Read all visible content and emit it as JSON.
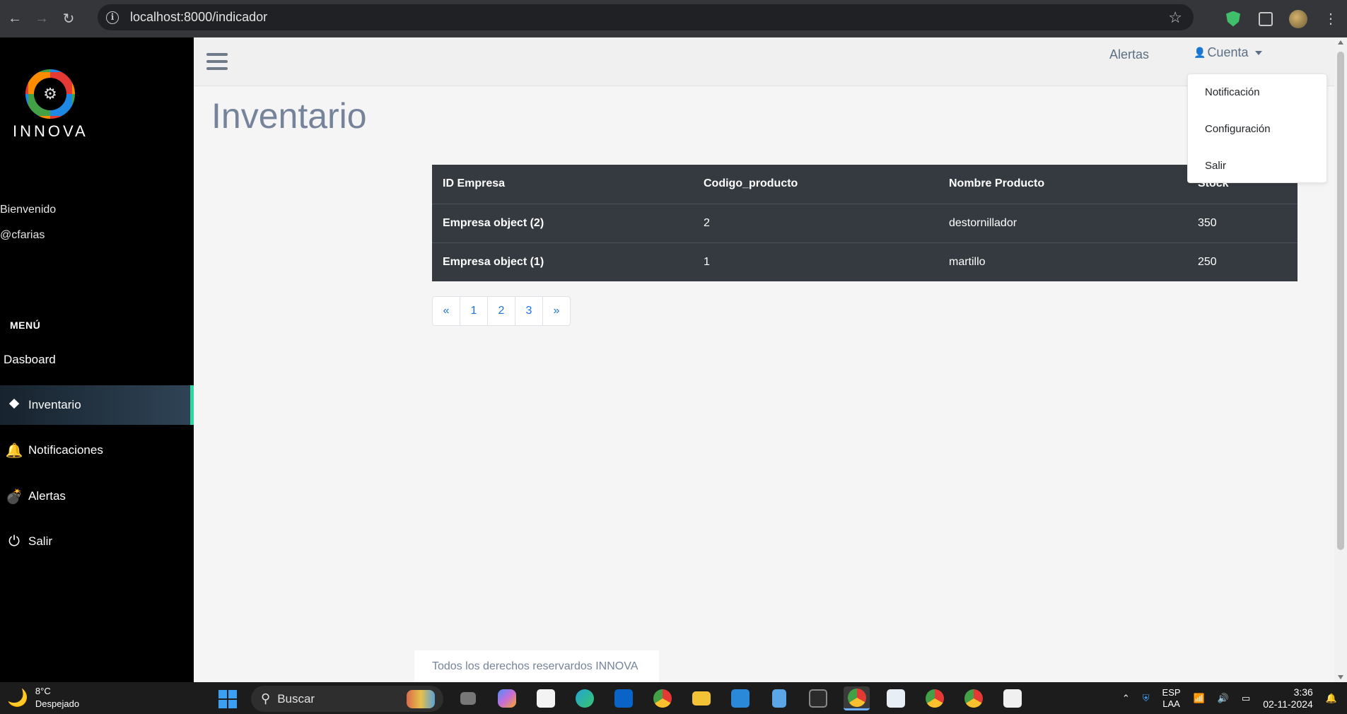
{
  "browser": {
    "url": "localhost:8000/indicador",
    "back_icon": "←",
    "forward_icon": "→",
    "reload_icon": "↻",
    "info_icon": "i",
    "star_icon": "☆",
    "kebab_icon": "⋮"
  },
  "sidebar": {
    "brand": "INNOVA",
    "welcome": "Bienvenido",
    "username": "@cfarias",
    "menu_title": "MENÚ",
    "items": [
      {
        "label": "Dasboard",
        "icon": ""
      },
      {
        "label": "Inventario",
        "icon": "⯁"
      },
      {
        "label": "Notificaciones",
        "icon": "🔔"
      },
      {
        "label": "Alertas",
        "icon": "💣"
      },
      {
        "label": "Salir",
        "icon": "⏻"
      }
    ],
    "active_item": "Inventario",
    "accent_color": "#2fd6a0"
  },
  "topnav": {
    "alertas": "Alertas",
    "cuenta": "Cuenta",
    "cuenta_icon": "👤"
  },
  "dropdown": {
    "items": [
      "Notificación",
      "Configuración",
      "Salir"
    ]
  },
  "main": {
    "title": "Inventario",
    "table": {
      "headers": [
        "ID Empresa",
        "Codigo_producto",
        "Nombre Producto",
        "Stock"
      ],
      "rows": [
        [
          "Empresa object (2)",
          "2",
          "destornillador",
          "350"
        ],
        [
          "Empresa object (1)",
          "1",
          "martillo",
          "250"
        ]
      ]
    },
    "pagination": [
      "«",
      "1",
      "2",
      "3",
      "»"
    ],
    "footer": "Todos los derechos reservardos INNOVA"
  },
  "taskbar": {
    "temperature": "8°C",
    "weather": "Despejado",
    "search_placeholder": "Buscar",
    "lang_top": "ESP",
    "lang_bottom": "LAA",
    "time": "3:36",
    "date": "02-11-2024"
  }
}
